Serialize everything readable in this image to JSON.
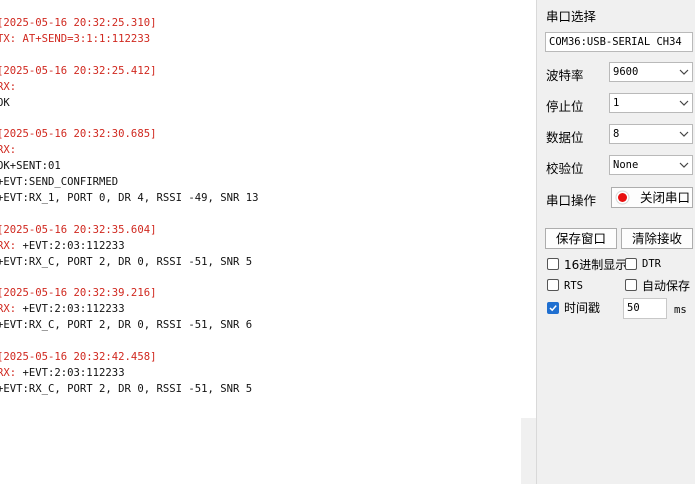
{
  "log": {
    "entries": [
      {
        "timestamp": "[2025-05-16 20:32:25.310]",
        "lines": [
          {
            "kind": "tx",
            "text": "TX: AT+SEND=3:1:1:112233"
          }
        ]
      },
      {
        "timestamp": "[2025-05-16 20:32:25.412]",
        "lines": [
          {
            "kind": "rx",
            "text": "RX:"
          },
          {
            "kind": "rxd",
            "text": "OK"
          }
        ]
      },
      {
        "timestamp": "[2025-05-16 20:32:30.685]",
        "lines": [
          {
            "kind": "rx",
            "text": "RX:"
          },
          {
            "kind": "rxd",
            "text": "OK+SENT:01"
          },
          {
            "kind": "rxd",
            "text": "+EVT:SEND_CONFIRMED"
          },
          {
            "kind": "rxd",
            "text": "+EVT:RX_1, PORT 0, DR 4, RSSI -49, SNR 13"
          }
        ]
      },
      {
        "timestamp": "[2025-05-16 20:32:35.604]",
        "lines": [
          {
            "kind": "rxinline",
            "prefix": "RX:",
            "text": " +EVT:2:03:112233"
          },
          {
            "kind": "rxd",
            "text": "+EVT:RX_C, PORT 2, DR 0, RSSI -51, SNR 5"
          }
        ]
      },
      {
        "timestamp": "[2025-05-16 20:32:39.216]",
        "lines": [
          {
            "kind": "rxinline",
            "prefix": "RX:",
            "text": " +EVT:2:03:112233"
          },
          {
            "kind": "rxd",
            "text": "+EVT:RX_C, PORT 2, DR 0, RSSI -51, SNR 6"
          }
        ]
      },
      {
        "timestamp": "[2025-05-16 20:32:42.458]",
        "lines": [
          {
            "kind": "rxinline",
            "prefix": "RX:",
            "text": " +EVT:2:03:112233"
          },
          {
            "kind": "rxd",
            "text": "+EVT:RX_C, PORT 2, DR 0, RSSI -51, SNR 5"
          }
        ]
      }
    ]
  },
  "panel": {
    "port_select_label": "串口选择",
    "port_value": "COM36:USB-SERIAL CH34",
    "baud_label": "波特率",
    "baud_value": "9600",
    "stopbits_label": "停止位",
    "stopbits_value": "1",
    "databits_label": "数据位",
    "databits_value": "8",
    "parity_label": "校验位",
    "parity_value": "None",
    "port_op_label": "串口操作",
    "close_port_button": "关闭串口",
    "save_window_button": "保存窗口",
    "clear_receive_button": "清除接收",
    "hex_display_label": "16进制显示",
    "hex_display_checked": false,
    "dtr_label": "DTR",
    "dtr_checked": false,
    "rts_label": "RTS",
    "rts_checked": false,
    "auto_save_label": "自动保存",
    "auto_save_checked": false,
    "timestamp_label": "时间戳",
    "timestamp_checked": true,
    "timeout_value": "50",
    "timeout_unit": "ms"
  },
  "colors": {
    "timestamp": "#d0281f",
    "checkbox_accent": "#1f6fd0",
    "indicator_red": "#e81010"
  }
}
